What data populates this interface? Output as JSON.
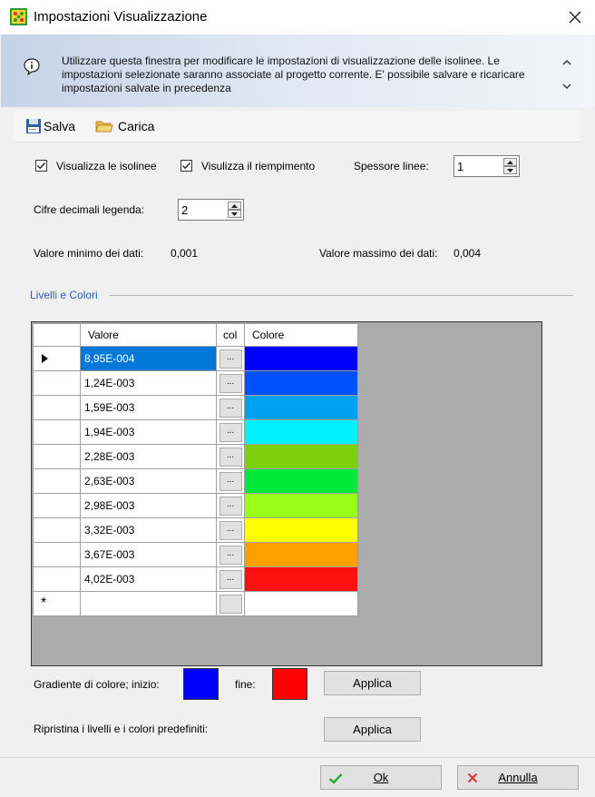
{
  "window": {
    "title": "Impostazioni Visualizzazione"
  },
  "info": {
    "text": "Utilizzare questa finestra per modificare le impostazioni di visualizzazione delle isolinee. Le impostazioni selezionate saranno associate al progetto corrente. E' possibile salvare e ricaricare impostazioni salvate in precedenza"
  },
  "toolbar": {
    "save_label": "Salva",
    "load_label": "Carica"
  },
  "options": {
    "show_isolines_label": "Visualizza le isolinee",
    "show_isolines_checked": true,
    "show_fill_label": "Visulizza il riempimento",
    "show_fill_checked": true,
    "line_width_label": "Spessore linee:",
    "line_width_value": "1",
    "decimals_label": "Cifre decimali legenda:",
    "decimals_value": "2",
    "min_label": "Valore minimo dei dati:",
    "min_value": "0,001",
    "max_label": "Valore massimo dei dati:",
    "max_value": "0,004"
  },
  "levels": {
    "group_label": "Livelli e Colori",
    "headers": {
      "value": "Valore",
      "col": "col",
      "color": "Colore"
    },
    "rows": [
      {
        "value": "8,95E-004",
        "color": "#0000ff"
      },
      {
        "value": "1,24E-003",
        "color": "#0050ff"
      },
      {
        "value": "1,59E-003",
        "color": "#00a0f0"
      },
      {
        "value": "1,94E-003",
        "color": "#00f0ff"
      },
      {
        "value": "2,28E-003",
        "color": "#7ed00a"
      },
      {
        "value": "2,63E-003",
        "color": "#00e83a"
      },
      {
        "value": "2,98E-003",
        "color": "#98ff16"
      },
      {
        "value": "3,32E-003",
        "color": "#ffff00"
      },
      {
        "value": "3,67E-003",
        "color": "#ffa000"
      },
      {
        "value": "4,02E-003",
        "color": "#ff1010"
      }
    ],
    "dots_label": "...",
    "new_row_marker": "*"
  },
  "gradient": {
    "label": "Gradiente di colore;  inizio:",
    "start_color": "#0000ff",
    "end_label": "fine:",
    "end_color": "#ff0000",
    "apply_label": "Applica"
  },
  "reset": {
    "label": "Ripristina i livelli e i colori predefiniti:",
    "apply_label": "Applica"
  },
  "footer": {
    "ok_label": "Ok",
    "cancel_label": "Annulla"
  }
}
